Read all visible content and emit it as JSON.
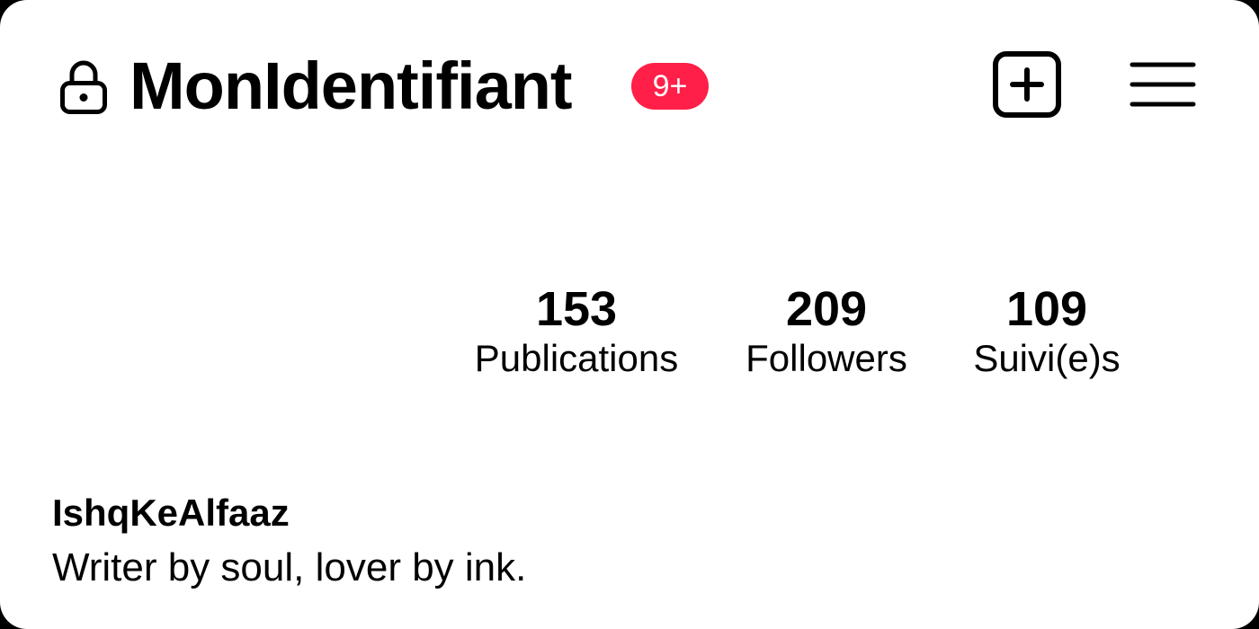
{
  "header": {
    "username": "MonIdentifiant",
    "notification_badge": "9+",
    "badge_color": "#ff1f48",
    "icons": {
      "lock": "lock-icon",
      "add": "add-square-icon",
      "menu": "hamburger-menu-icon"
    }
  },
  "stats": [
    {
      "value": "153",
      "label": "Publications"
    },
    {
      "value": "209",
      "label": "Followers"
    },
    {
      "value": "109",
      "label": "Suivi(e)s"
    }
  ],
  "profile": {
    "display_name": "IshqKeAlfaaz",
    "bio": "Writer by soul, lover by ink."
  }
}
